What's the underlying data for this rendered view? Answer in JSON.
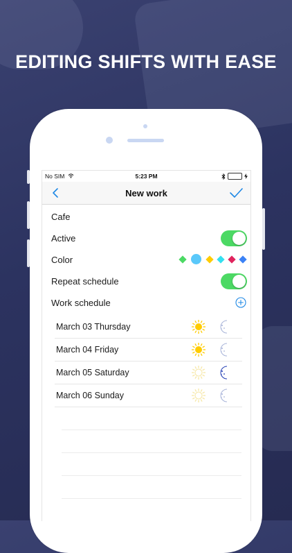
{
  "headline": "EDITING SHIFTS WITH EASE",
  "status_bar": {
    "carrier": "No SIM",
    "time": "5:23 PM"
  },
  "nav": {
    "title": "New work"
  },
  "form": {
    "name_value": "Cafe",
    "active_label": "Active",
    "active_on": true,
    "color_label": "Color",
    "colors": [
      "#4cd964",
      "#5ac8fa",
      "#ffcc00",
      "#34e0f0",
      "#e0245e",
      "#3b82f6"
    ],
    "selected_color": "#5ac8fa",
    "repeat_label": "Repeat schedule",
    "repeat_on": true,
    "work_schedule_label": "Work schedule"
  },
  "schedule": [
    {
      "date": "March 03 Thursday",
      "day": true,
      "night": false
    },
    {
      "date": "March 04 Friday",
      "day": true,
      "night": false
    },
    {
      "date": "March 05 Saturday",
      "day": false,
      "night": true
    },
    {
      "date": "March 06 Sunday",
      "day": false,
      "night": false
    }
  ],
  "colors": {
    "accent": "#1e88e5",
    "toggle": "#4cd964",
    "sun_active": "#ffcc00",
    "moon_active": "#1f3bb3"
  }
}
